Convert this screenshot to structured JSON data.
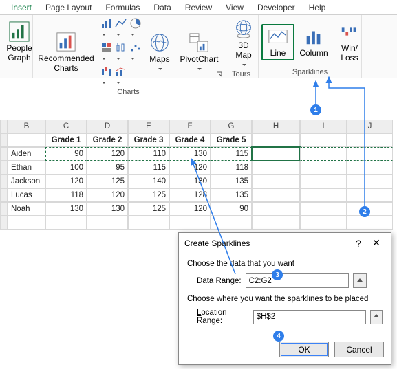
{
  "tabs": {
    "insert": "Insert",
    "page_layout": "Page Layout",
    "formulas": "Formulas",
    "data": "Data",
    "review": "Review",
    "view": "View",
    "developer": "Developer",
    "help": "Help"
  },
  "ribbon": {
    "people_graph": "People\nGraph",
    "rec_charts": "Recommended\nCharts",
    "maps": "Maps",
    "pivot": "PivotChart",
    "map3d": "3D\nMap",
    "line": "Line",
    "column": "Column",
    "winloss": "Win/\nLoss",
    "grp_charts": "Charts",
    "grp_tours": "Tours",
    "grp_spark": "Sparklines"
  },
  "sheet": {
    "cols": [
      "B",
      "C",
      "D",
      "E",
      "F",
      "G",
      "H",
      "I",
      "J"
    ],
    "headers": [
      "Grade 1",
      "Grade 2",
      "Grade 3",
      "Grade 4",
      "Grade 5"
    ],
    "rows": [
      {
        "name": "Aiden",
        "v": [
          90,
          120,
          110,
          130,
          115
        ]
      },
      {
        "name": "Ethan",
        "v": [
          100,
          95,
          115,
          120,
          118
        ]
      },
      {
        "name": "Jackson",
        "v": [
          120,
          125,
          140,
          130,
          135
        ]
      },
      {
        "name": "Lucas",
        "v": [
          118,
          120,
          125,
          128,
          135
        ]
      },
      {
        "name": "Noah",
        "v": [
          130,
          130,
          125,
          120,
          90
        ]
      }
    ]
  },
  "dialog": {
    "title": "Create Sparklines",
    "sect1": "Choose the data that you want",
    "data_range_lbl": "Data Range:",
    "data_range_val": "C2:G2",
    "sect2": "Choose where you want the sparklines to be placed",
    "loc_range_lbl": "Location Range:",
    "loc_range_val": "$H$2",
    "ok": "OK",
    "cancel": "Cancel"
  },
  "badges": {
    "b1": "1",
    "b2": "2",
    "b3": "3",
    "b4": "4"
  }
}
